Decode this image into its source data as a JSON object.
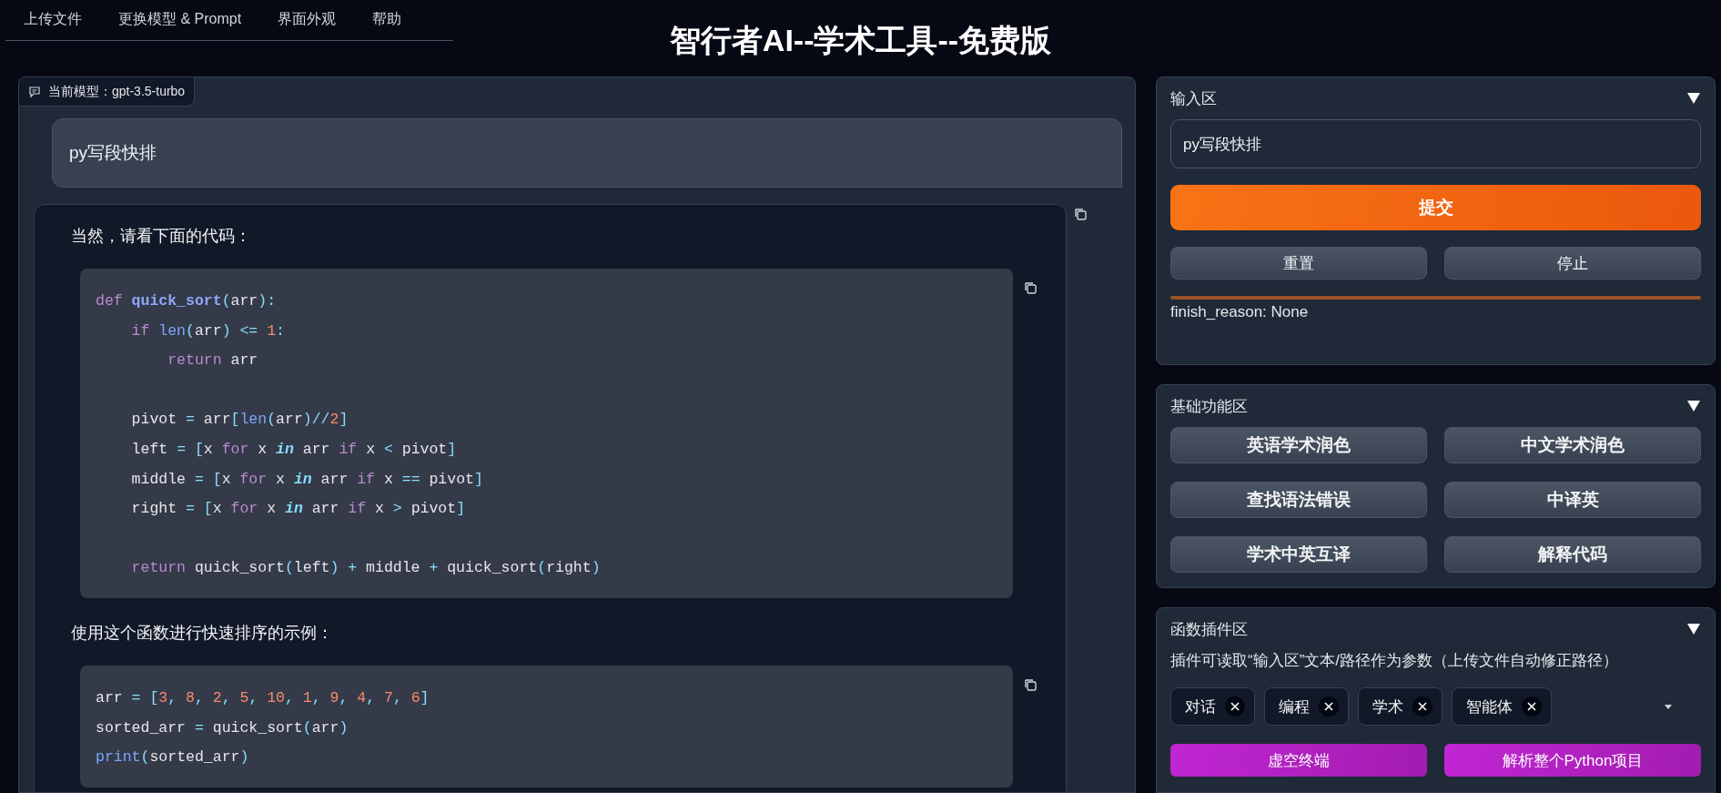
{
  "nav_tabs": [
    {
      "label": "上传文件",
      "selected": false
    },
    {
      "label": "更换模型 & Prompt",
      "selected": false
    },
    {
      "label": "界面外观",
      "selected": false
    },
    {
      "label": "帮助",
      "selected": false
    }
  ],
  "title": "智行者AI--学术工具--免费版",
  "chat": {
    "model_label": "当前模型：gpt-3.5-turbo",
    "messages": [
      {
        "kind": "user",
        "text": "py写段快排"
      },
      {
        "kind": "assistant",
        "blocks": [
          {
            "kind": "text",
            "text": "当然，请看下面的代码："
          },
          {
            "kind": "code",
            "lines": [
              {
                "kind": "code",
                "tokens": [
                  {
                    "text": "def ",
                    "kind": "keyword"
                  },
                  {
                    "text": "quick_sort",
                    "kind": "function"
                  },
                  {
                    "text": "(",
                    "kind": "operator"
                  },
                  {
                    "text": "arr",
                    "kind": "plain"
                  },
                  {
                    "text": "):",
                    "kind": "operator"
                  }
                ]
              },
              {
                "kind": "code",
                "tokens": [
                  {
                    "text": "    if ",
                    "kind": "keyword"
                  },
                  {
                    "text": "len",
                    "kind": "builtin"
                  },
                  {
                    "text": "(",
                    "kind": "operator"
                  },
                  {
                    "text": "arr",
                    "kind": "plain"
                  },
                  {
                    "text": ") <= ",
                    "kind": "operator"
                  },
                  {
                    "text": "1",
                    "kind": "number"
                  },
                  {
                    "text": ":",
                    "kind": "operator"
                  }
                ]
              },
              {
                "kind": "code",
                "tokens": [
                  {
                    "text": "        return ",
                    "kind": "keyword"
                  },
                  {
                    "text": "arr",
                    "kind": "plain"
                  }
                ]
              },
              {
                "kind": "blank"
              },
              {
                "kind": "code",
                "tokens": [
                  {
                    "text": "    pivot ",
                    "kind": "plain"
                  },
                  {
                    "text": "= ",
                    "kind": "operator"
                  },
                  {
                    "text": "arr",
                    "kind": "plain"
                  },
                  {
                    "text": "[",
                    "kind": "operator"
                  },
                  {
                    "text": "len",
                    "kind": "builtin"
                  },
                  {
                    "text": "(",
                    "kind": "operator"
                  },
                  {
                    "text": "arr",
                    "kind": "plain"
                  },
                  {
                    "text": ")//",
                    "kind": "operator"
                  },
                  {
                    "text": "2",
                    "kind": "number"
                  },
                  {
                    "text": "]",
                    "kind": "operator"
                  }
                ]
              },
              {
                "kind": "code",
                "tokens": [
                  {
                    "text": "    left ",
                    "kind": "plain"
                  },
                  {
                    "text": "= [",
                    "kind": "operator"
                  },
                  {
                    "text": "x ",
                    "kind": "plain"
                  },
                  {
                    "text": "for ",
                    "kind": "keyword"
                  },
                  {
                    "text": "x ",
                    "kind": "plain"
                  },
                  {
                    "text": "in",
                    "kind": "keyword_emphasis"
                  },
                  {
                    "text": " arr ",
                    "kind": "plain"
                  },
                  {
                    "text": "if ",
                    "kind": "keyword"
                  },
                  {
                    "text": "x ",
                    "kind": "plain"
                  },
                  {
                    "text": "< ",
                    "kind": "operator"
                  },
                  {
                    "text": "pivot",
                    "kind": "plain"
                  },
                  {
                    "text": "]",
                    "kind": "operator"
                  }
                ]
              },
              {
                "kind": "code",
                "tokens": [
                  {
                    "text": "    middle ",
                    "kind": "plain"
                  },
                  {
                    "text": "= [",
                    "kind": "operator"
                  },
                  {
                    "text": "x ",
                    "kind": "plain"
                  },
                  {
                    "text": "for ",
                    "kind": "keyword"
                  },
                  {
                    "text": "x ",
                    "kind": "plain"
                  },
                  {
                    "text": "in",
                    "kind": "keyword_emphasis"
                  },
                  {
                    "text": " arr ",
                    "kind": "plain"
                  },
                  {
                    "text": "if ",
                    "kind": "keyword"
                  },
                  {
                    "text": "x ",
                    "kind": "plain"
                  },
                  {
                    "text": "== ",
                    "kind": "operator"
                  },
                  {
                    "text": "pivot",
                    "kind": "plain"
                  },
                  {
                    "text": "]",
                    "kind": "operator"
                  }
                ]
              },
              {
                "kind": "code",
                "tokens": [
                  {
                    "text": "    right ",
                    "kind": "plain"
                  },
                  {
                    "text": "= [",
                    "kind": "operator"
                  },
                  {
                    "text": "x ",
                    "kind": "plain"
                  },
                  {
                    "text": "for ",
                    "kind": "keyword"
                  },
                  {
                    "text": "x ",
                    "kind": "plain"
                  },
                  {
                    "text": "in",
                    "kind": "keyword_emphasis"
                  },
                  {
                    "text": " arr ",
                    "kind": "plain"
                  },
                  {
                    "text": "if ",
                    "kind": "keyword"
                  },
                  {
                    "text": "x ",
                    "kind": "plain"
                  },
                  {
                    "text": "> ",
                    "kind": "operator"
                  },
                  {
                    "text": "pivot",
                    "kind": "plain"
                  },
                  {
                    "text": "]",
                    "kind": "operator"
                  }
                ]
              },
              {
                "kind": "blank"
              },
              {
                "kind": "code",
                "tokens": [
                  {
                    "text": "    return ",
                    "kind": "keyword"
                  },
                  {
                    "text": "quick_sort",
                    "kind": "plain"
                  },
                  {
                    "text": "(",
                    "kind": "operator"
                  },
                  {
                    "text": "left",
                    "kind": "plain"
                  },
                  {
                    "text": ") + ",
                    "kind": "operator"
                  },
                  {
                    "text": "middle ",
                    "kind": "plain"
                  },
                  {
                    "text": "+ ",
                    "kind": "operator"
                  },
                  {
                    "text": "quick_sort",
                    "kind": "plain"
                  },
                  {
                    "text": "(",
                    "kind": "operator"
                  },
                  {
                    "text": "right",
                    "kind": "plain"
                  },
                  {
                    "text": ")",
                    "kind": "operator"
                  }
                ]
              }
            ]
          },
          {
            "kind": "text",
            "text": "使用这个函数进行快速排序的示例："
          },
          {
            "kind": "code",
            "lines": [
              {
                "kind": "code",
                "tokens": [
                  {
                    "text": "arr ",
                    "kind": "plain"
                  },
                  {
                    "text": "= [",
                    "kind": "operator"
                  },
                  {
                    "text": "3",
                    "kind": "number"
                  },
                  {
                    "text": ", ",
                    "kind": "operator"
                  },
                  {
                    "text": "8",
                    "kind": "number"
                  },
                  {
                    "text": ", ",
                    "kind": "operator"
                  },
                  {
                    "text": "2",
                    "kind": "number"
                  },
                  {
                    "text": ", ",
                    "kind": "operator"
                  },
                  {
                    "text": "5",
                    "kind": "number"
                  },
                  {
                    "text": ", ",
                    "kind": "operator"
                  },
                  {
                    "text": "10",
                    "kind": "number"
                  },
                  {
                    "text": ", ",
                    "kind": "operator"
                  },
                  {
                    "text": "1",
                    "kind": "number"
                  },
                  {
                    "text": ", ",
                    "kind": "operator"
                  },
                  {
                    "text": "9",
                    "kind": "number"
                  },
                  {
                    "text": ", ",
                    "kind": "operator"
                  },
                  {
                    "text": "4",
                    "kind": "number"
                  },
                  {
                    "text": ", ",
                    "kind": "operator"
                  },
                  {
                    "text": "7",
                    "kind": "number"
                  },
                  {
                    "text": ", ",
                    "kind": "operator"
                  },
                  {
                    "text": "6",
                    "kind": "number"
                  },
                  {
                    "text": "]",
                    "kind": "operator"
                  }
                ]
              },
              {
                "kind": "code",
                "tokens": [
                  {
                    "text": "sorted_arr ",
                    "kind": "plain"
                  },
                  {
                    "text": "= ",
                    "kind": "operator"
                  },
                  {
                    "text": "quick_sort",
                    "kind": "plain"
                  },
                  {
                    "text": "(",
                    "kind": "operator"
                  },
                  {
                    "text": "arr",
                    "kind": "plain"
                  },
                  {
                    "text": ")",
                    "kind": "operator"
                  }
                ]
              },
              {
                "kind": "code",
                "tokens": [
                  {
                    "text": "print",
                    "kind": "builtin"
                  },
                  {
                    "text": "(",
                    "kind": "operator"
                  },
                  {
                    "text": "sorted_arr",
                    "kind": "plain"
                  },
                  {
                    "text": ")",
                    "kind": "operator"
                  }
                ]
              }
            ]
          }
        ]
      }
    ]
  },
  "input_panel": {
    "title": "输入区",
    "expanded": true,
    "input_value": "py写段快排",
    "submit": "提交",
    "buttons": [
      "重置",
      "停止"
    ],
    "finish_reason": "finish_reason: None"
  },
  "basic_panel": {
    "title": "基础功能区",
    "expanded": true,
    "buttons": [
      "英语学术润色",
      "中文学术润色",
      "查找语法错误",
      "中译英",
      "学术中英互译",
      "解释代码"
    ]
  },
  "plugin_panel": {
    "title": "函数插件区",
    "expanded": true,
    "hint": "插件可读取“输入区”文本/路径作为参数（上传文件自动修正路径）",
    "tags": [
      "对话",
      "编程",
      "学术",
      "智能体"
    ],
    "buttons": [
      "虚空终端",
      "解析整个Python项目"
    ]
  }
}
